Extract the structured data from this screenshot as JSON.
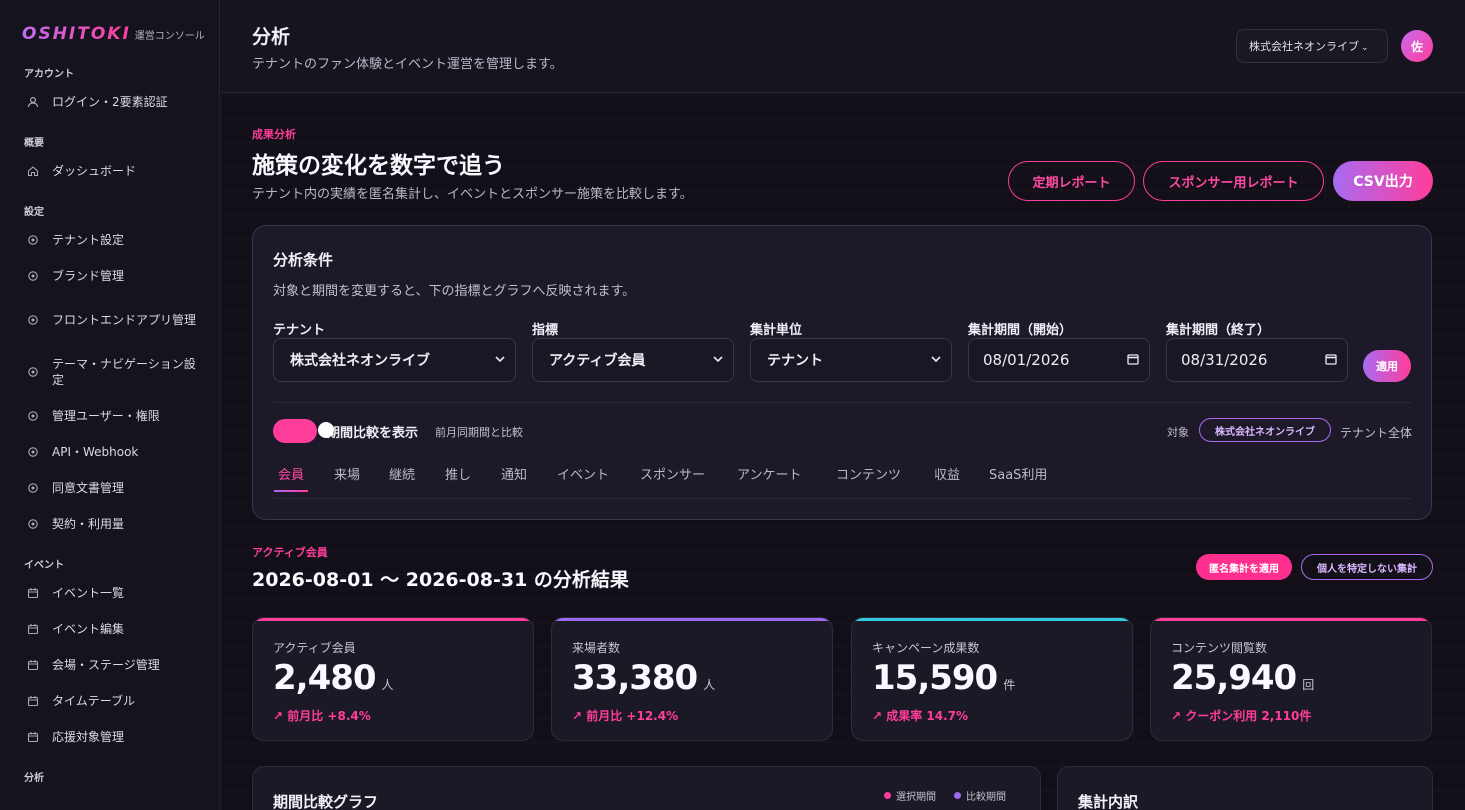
{
  "brand": {
    "logo": "OSHITOKI",
    "sub": "運営コンソール"
  },
  "sidebar": {
    "sections": [
      {
        "title": "アカウント",
        "items": [
          {
            "label": "ログイン・2要素認証",
            "icon": "user-icon"
          }
        ]
      },
      {
        "title": "概要",
        "items": [
          {
            "label": "ダッシュボード",
            "icon": "home-icon"
          }
        ]
      },
      {
        "title": "設定",
        "items": [
          {
            "label": "テナント設定",
            "icon": "settings-icon"
          },
          {
            "label": "ブランド管理",
            "icon": "settings-icon"
          },
          {
            "label": "フロントエンドアプリ管理",
            "icon": "settings-icon"
          },
          {
            "label": "テーマ・ナビゲーション設定",
            "icon": "settings-icon"
          },
          {
            "label": "管理ユーザー・権限",
            "icon": "settings-icon"
          },
          {
            "label": "API・Webhook",
            "icon": "settings-icon"
          },
          {
            "label": "同意文書管理",
            "icon": "settings-icon"
          },
          {
            "label": "契約・利用量",
            "icon": "settings-icon"
          }
        ]
      },
      {
        "title": "イベント",
        "items": [
          {
            "label": "イベント一覧",
            "icon": "calendar-icon"
          },
          {
            "label": "イベント編集",
            "icon": "calendar-icon"
          },
          {
            "label": "会場・ステージ管理",
            "icon": "calendar-icon"
          },
          {
            "label": "タイムテーブル",
            "icon": "calendar-icon"
          },
          {
            "label": "応援対象管理",
            "icon": "calendar-icon"
          }
        ]
      },
      {
        "title": "分析",
        "items": []
      }
    ]
  },
  "header": {
    "title": "分析",
    "desc": "テナントのファン体験とイベント運営を管理します。",
    "tenant_select": "株式会社ネオンライブ",
    "avatar": "佐"
  },
  "hero": {
    "eyebrow": "成果分析",
    "title": "施策の変化を数字で追う",
    "desc": "テナント内の実績を匿名集計し、イベントとスポンサー施策を比較します。",
    "btn_periodic": "定期レポート",
    "btn_sponsor": "スポンサー用レポート",
    "btn_csv": "CSV出力"
  },
  "conditions": {
    "title": "分析条件",
    "desc": "対象と期間を変更すると、下の指標とグラフへ反映されます。",
    "tenant_label": "テナント",
    "tenant_value": "株式会社ネオンライブ",
    "metric_label": "指標",
    "metric_value": "アクティブ会員",
    "unit_label": "集計単位",
    "unit_value": "テナント",
    "start_label": "集計期間（開始）",
    "start_value": "08/01/2026",
    "end_label": "集計期間（終了）",
    "end_value": "08/31/2026",
    "apply": "適用",
    "toggle_label": "期間比較を表示",
    "toggle_sub": "前月同期間と比較",
    "toggle_on": true,
    "target_label": "対象",
    "target_chip": "株式会社ネオンライブ",
    "target_all": "テナント全体",
    "tabs": [
      "会員",
      "来場",
      "継続",
      "推し",
      "通知",
      "イベント",
      "スポンサー",
      "アンケート",
      "コンテンツ",
      "収益",
      "SaaS利用"
    ],
    "active_tab": "会員"
  },
  "results": {
    "eyebrow": "アクティブ会員",
    "title": "2026-08-01 〜 2026-08-31 の分析結果",
    "badge_anon": "匿名集計を適用",
    "badge_noid": "個人を特定しない集計"
  },
  "kpis": [
    {
      "label": "アクティブ会員",
      "value": "2,480",
      "unit": "人",
      "delta": "↗ 前月比 +8.4%",
      "color": "#ff3d9a"
    },
    {
      "label": "来場者数",
      "value": "33,380",
      "unit": "人",
      "delta": "↗ 前月比 +12.4%",
      "color": "#9b6bf2"
    },
    {
      "label": "キャンペーン成果数",
      "value": "15,590",
      "unit": "件",
      "delta": "↗ 成果率 14.7%",
      "color": "#35c9e0"
    },
    {
      "label": "コンテンツ閲覧数",
      "value": "25,940",
      "unit": "回",
      "delta": "↗ クーポン利用 2,110件",
      "color": "#ff3d9a"
    }
  ],
  "bottom": {
    "chart_title": "期間比較グラフ",
    "legend_selected": "選択期間",
    "legend_compare": "比較期間",
    "legend_selected_color": "#ff3d9a",
    "legend_compare_color": "#9b6bf2",
    "breakdown_title": "集計内訳"
  }
}
